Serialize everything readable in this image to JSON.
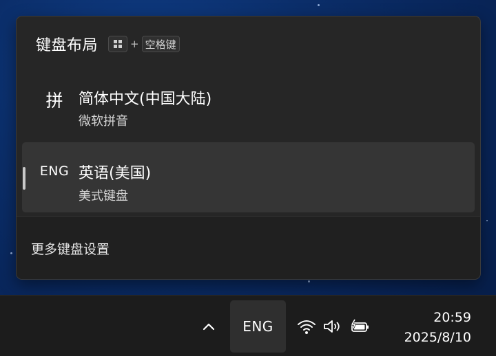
{
  "flyout": {
    "title": "键盘布局",
    "shortcut": {
      "win_key_icon": "windows-logo-icon",
      "plus": "+",
      "key_label": "空格键"
    },
    "languages": [
      {
        "code": "拼",
        "name": "简体中文(中国大陆)",
        "method": "微软拼音",
        "selected": false
      },
      {
        "code": "ENG",
        "name": "英语(美国)",
        "method": "美式键盘",
        "selected": true
      }
    ],
    "footer_link": "更多键盘设置"
  },
  "taskbar": {
    "overflow_icon": "chevron-up-icon",
    "ime_label": "ENG",
    "status_icons": [
      "wifi-icon",
      "speaker-icon",
      "battery-charging-icon"
    ],
    "time": "20:59",
    "date": "2025/8/10"
  },
  "colors": {
    "flyout_bg": "#262626",
    "selected_bg": "#353535",
    "taskbar_bg": "#1c1c1c",
    "wallpaper": "#0b2e6a"
  }
}
